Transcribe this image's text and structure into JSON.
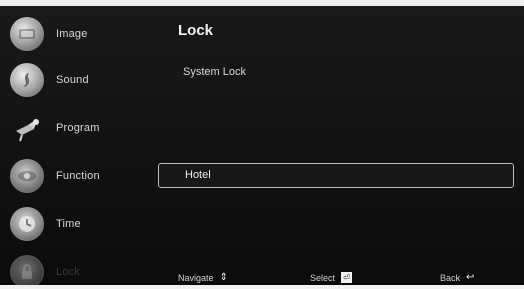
{
  "sidebar": {
    "items": [
      {
        "label": "Image",
        "icon": "image-icon"
      },
      {
        "label": "Sound",
        "icon": "sound-icon"
      },
      {
        "label": "Program",
        "icon": "program-icon"
      },
      {
        "label": "Function",
        "icon": "function-icon"
      },
      {
        "label": "Time",
        "icon": "time-icon"
      },
      {
        "label": "Lock",
        "icon": "lock-icon"
      }
    ]
  },
  "main": {
    "title": "Lock",
    "items": [
      {
        "label": "System Lock"
      },
      {
        "label": "Hotel"
      }
    ]
  },
  "footer": {
    "navigate": "Navigate",
    "select": "Select",
    "back": "Back"
  }
}
